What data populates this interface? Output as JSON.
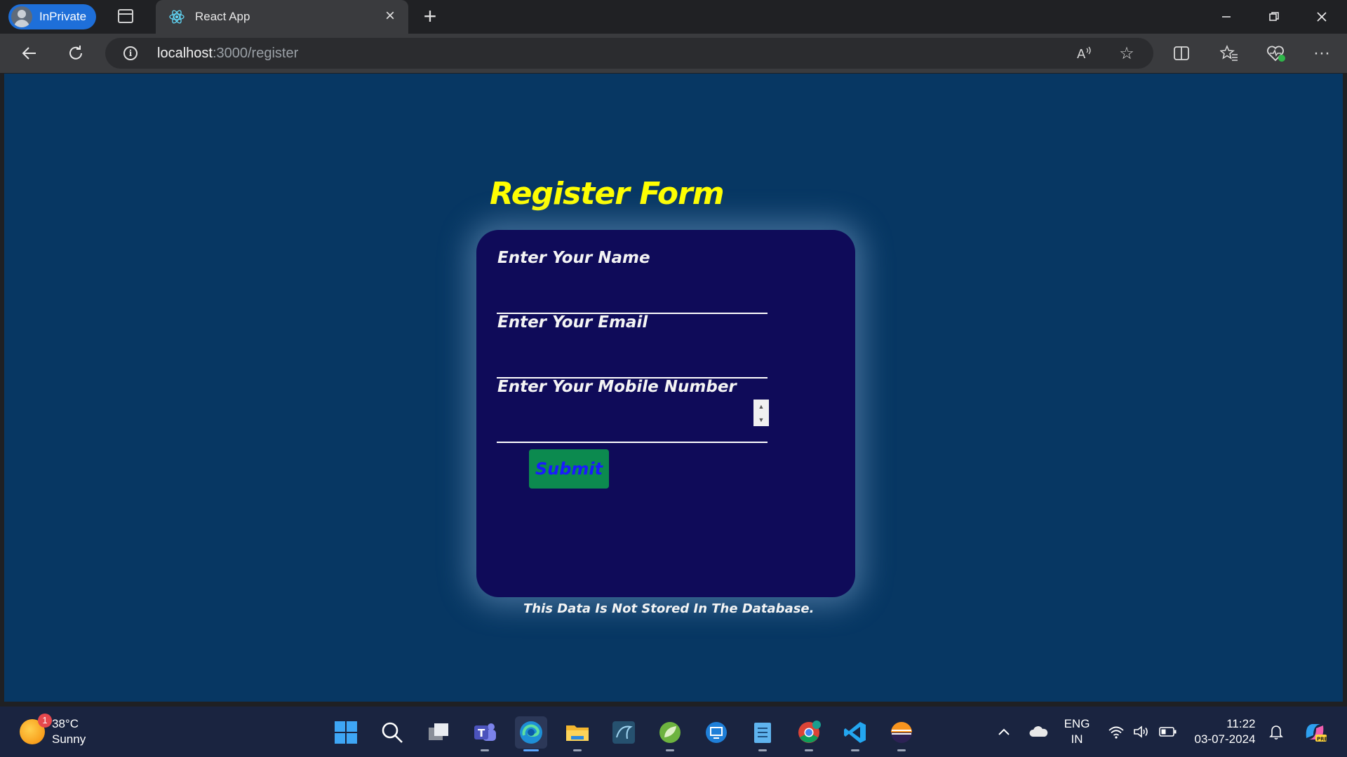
{
  "browser": {
    "inprivate_label": "InPrivate",
    "tab_title": "React App",
    "url_host": "localhost",
    "url_path": ":3000/register"
  },
  "page": {
    "title": "Register Form",
    "fields": [
      {
        "label": "Enter Your Name",
        "value": ""
      },
      {
        "label": "Enter Your Email",
        "value": ""
      },
      {
        "label": "Enter Your Mobile Number",
        "value": ""
      }
    ],
    "submit_label": "Submit",
    "footnote": "This Data Is Not Stored In The Database.",
    "colors": {
      "background": "#073763",
      "card": "#0f0b59",
      "title": "#ffff00",
      "button": "#0c8a4f",
      "button_text": "#1a1aff"
    }
  },
  "taskbar": {
    "weather_temp": "38°C",
    "weather_desc": "Sunny",
    "weather_badge": "1",
    "lang_line1": "ENG",
    "lang_line2": "IN",
    "time": "11:22",
    "date": "03-07-2024",
    "apps": [
      "start-icon",
      "search-icon",
      "task-view-icon",
      "teams-icon",
      "edge-icon",
      "file-explorer-icon",
      "mysql-workbench-icon",
      "spring-tools-icon",
      "remote-desktop-icon",
      "notepad-icon",
      "chrome-icon",
      "vscode-icon",
      "eclipse-icon"
    ]
  }
}
